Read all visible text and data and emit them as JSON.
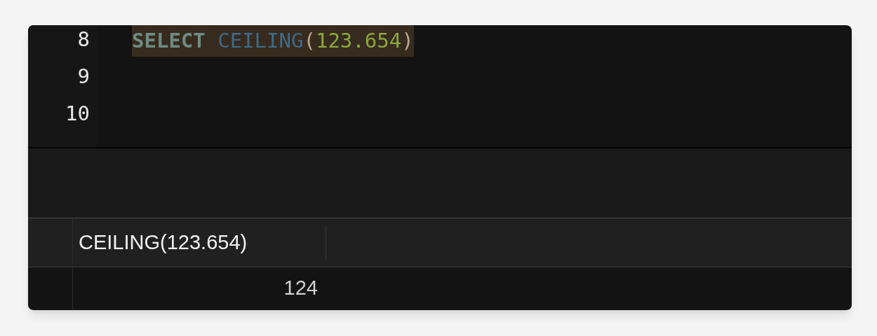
{
  "editor": {
    "lines": [
      {
        "number": "8",
        "tokens": [
          {
            "kind": "keyword",
            "text": "SELECT"
          },
          {
            "kind": "function",
            "text": "CEILING"
          },
          {
            "kind": "paren",
            "text": "("
          },
          {
            "kind": "number",
            "text": "123.654"
          },
          {
            "kind": "paren",
            "text": ")"
          }
        ]
      },
      {
        "number": "9"
      },
      {
        "number": "10"
      }
    ]
  },
  "results": {
    "columns": [
      "CEILING(123.654)"
    ],
    "rows": [
      [
        "124"
      ]
    ]
  }
}
